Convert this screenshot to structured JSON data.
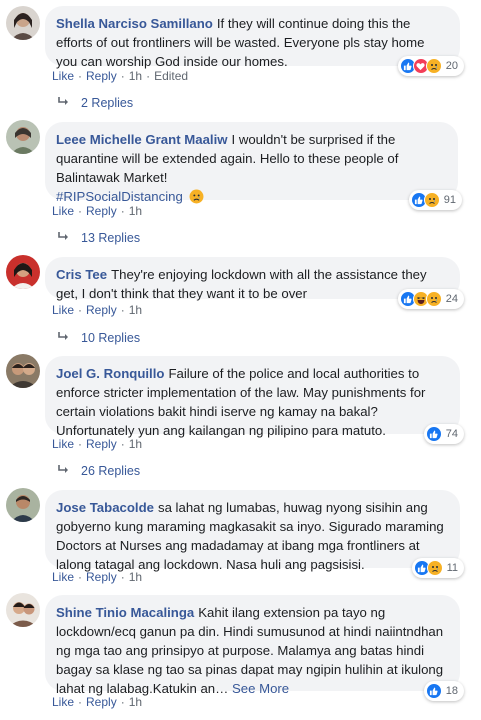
{
  "comments": [
    {
      "author": "Shella Narciso Samillano",
      "text": "If they will continue doing this the efforts of out frontliners will be wasted. Everyone pls stay home you can worship God inside our homes.",
      "like": "Like",
      "reply": "Reply",
      "time": "1h",
      "edited": "Edited",
      "reaction_count": "20",
      "reaction_icons": [
        "like-icon",
        "love-icon",
        "sad-icon"
      ],
      "replies_label": "2 Replies"
    },
    {
      "author": "Leee Michelle Grant Maaliw",
      "text": "I wouldn't be surprised if the quarantine will be extended again. Hello to these people of Balintawak Market!",
      "hashtag": "#RIPSocialDistancing",
      "like": "Like",
      "reply": "Reply",
      "time": "1h",
      "reaction_count": "91",
      "reaction_icons": [
        "like-icon",
        "sad-icon"
      ],
      "replies_label": "13 Replies"
    },
    {
      "author": "Cris Tee",
      "text": "They're enjoying lockdown with all the assistance they get, I don't think that they want it to be over",
      "like": "Like",
      "reply": "Reply",
      "time": "1h",
      "reaction_count": "24",
      "reaction_icons": [
        "like-icon",
        "haha-icon",
        "sad-icon"
      ],
      "replies_label": "10 Replies"
    },
    {
      "author": "Joel G. Ronquillo",
      "text": "Failure of the police and local authorities to enforce stricter implementation of the law. May punishments for certain violations bakit hindi iserve ng kamay na bakal? Unfortunately yun ang kailangan ng pilipino para matuto.",
      "like": "Like",
      "reply": "Reply",
      "time": "1h",
      "reaction_count": "74",
      "reaction_icons": [
        "like-icon"
      ],
      "replies_label": "26 Replies"
    },
    {
      "author": "Jose Tabacolde",
      "text": "sa lahat ng lumabas, huwag nyong sisihin ang gobyerno kung maraming magkasakit sa inyo. Sigurado maraming Doctors at Nurses ang madadamay at ibang mga frontliners at lalong tatagal ang lockdown. Nasa huli ang pagsisisi.",
      "like": "Like",
      "reply": "Reply",
      "time": "1h",
      "reaction_count": "11",
      "reaction_icons": [
        "like-icon",
        "sad-icon"
      ]
    },
    {
      "author": "Shine Tinio Macalinga",
      "text": "Kahit ilang extension pa tayo ng lockdown/ecq ganun pa din. Hindi sumusunod at hindi naiintndhan ng mga tao ang prinsipyo at purpose. Malamya ang batas hindi bagay sa klase ng tao sa pinas dapat may ngipin hulihin at ikulong lahat ng lalabag.Katukin an…",
      "see_more": "See More",
      "like": "Like",
      "reply": "Reply",
      "time": "1h",
      "reaction_count": "18",
      "reaction_icons": [
        "like-icon"
      ]
    }
  ],
  "colors": {
    "link": "#385898",
    "bubble": "#f2f3f5",
    "meta": "#606770",
    "like": "#1877f2",
    "love": "#f33e58",
    "sad": "#f7b125"
  }
}
